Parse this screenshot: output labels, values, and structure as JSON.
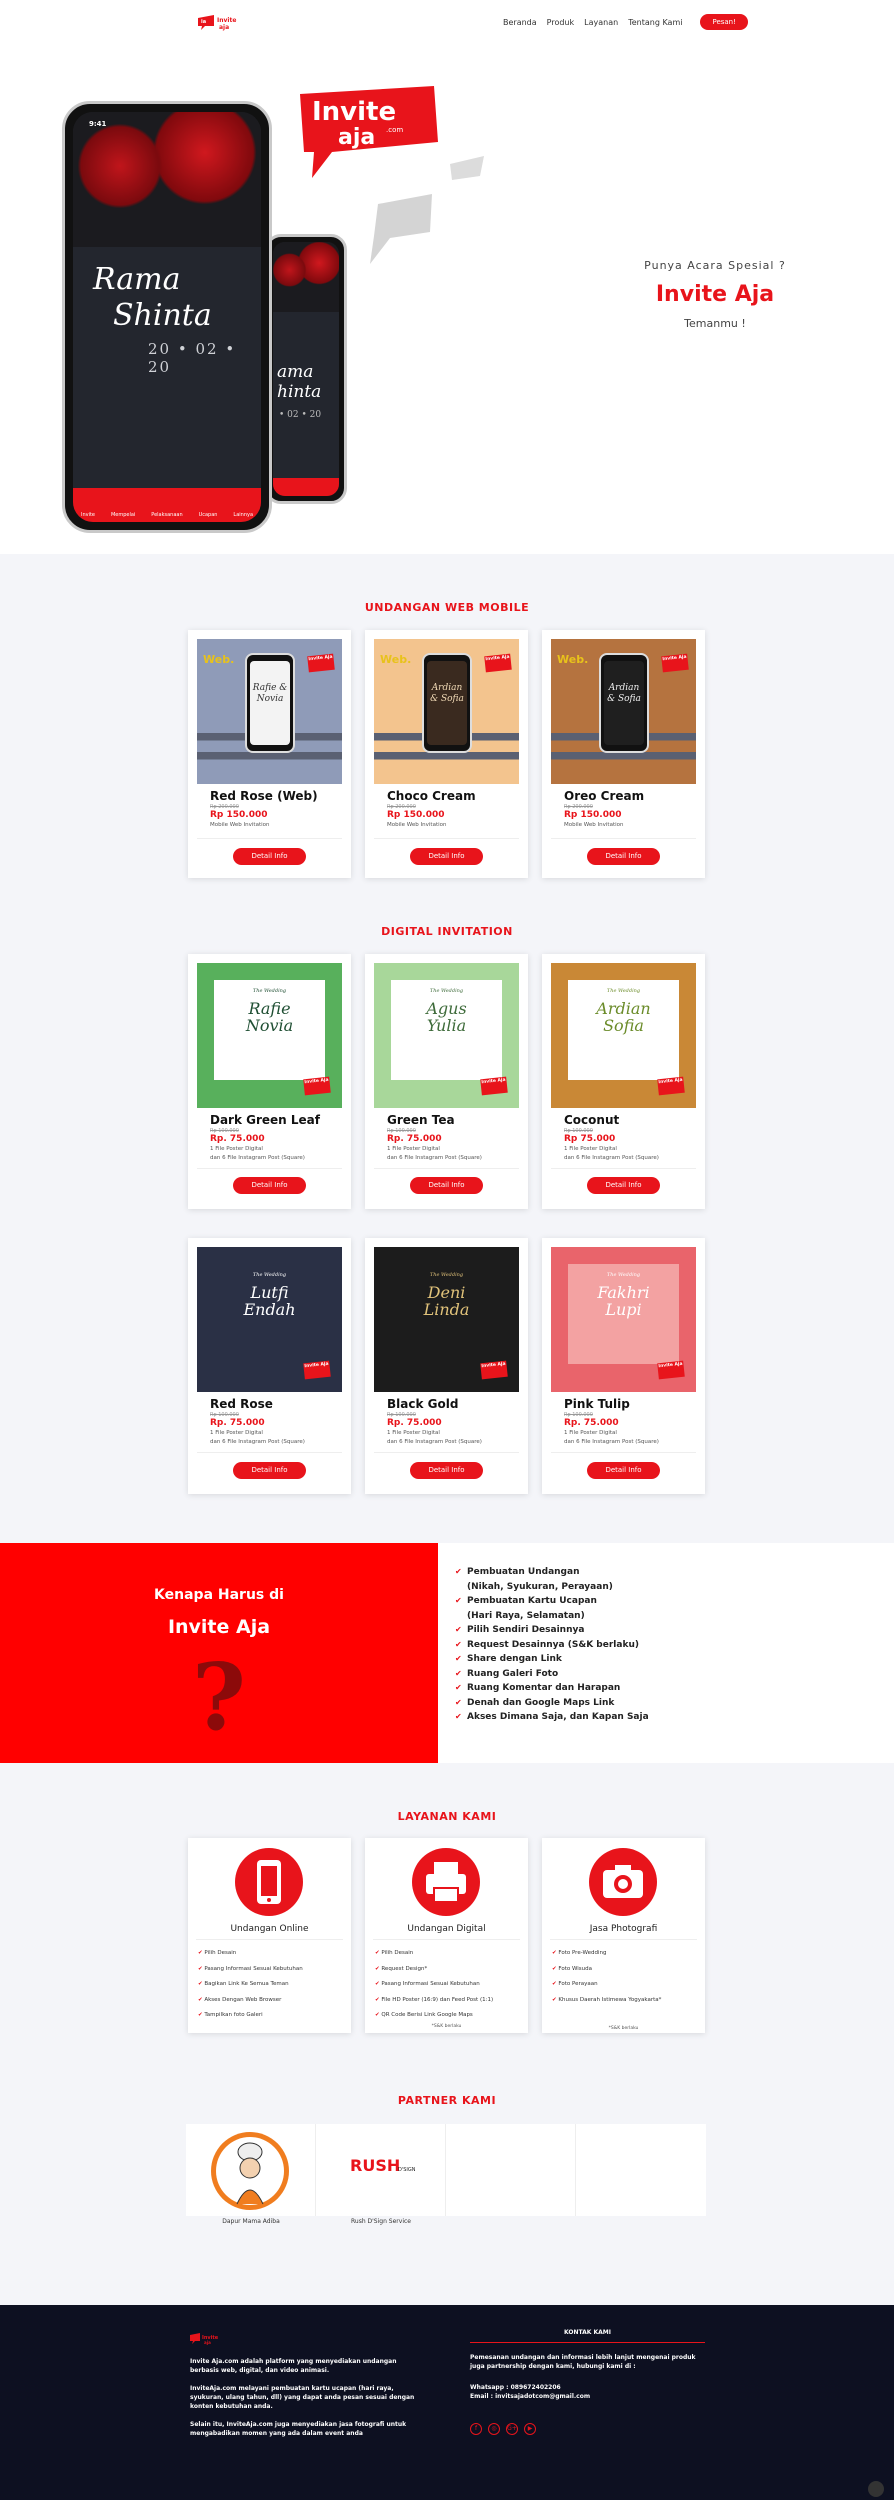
{
  "nav": {
    "logo_text": "Invite Aja",
    "items": [
      "Beranda",
      "Produk",
      "Layanan",
      "Tentang Kami"
    ],
    "cta": "Pesan!"
  },
  "hero": {
    "phone_names_1": "Rama",
    "phone_names_2": "Shinta",
    "phone_date": "20 • 02 • 20",
    "phone_time": "9:41",
    "back_names_1": "ama",
    "back_names_2": "hinta",
    "back_date": "• 02 • 20",
    "tabs": [
      "Invite",
      "Mempelai",
      "Pelaksanaan",
      "Ucapan",
      "Lainnya"
    ],
    "bubble": "Invite aja.com",
    "tag1": "Punya Acara Spesial ?",
    "brand": "Invite Aja",
    "tag2": "Temanmu !"
  },
  "web": {
    "title": "UNDANGAN WEB MOBILE",
    "web_tag": "Web.",
    "flag": "Invite Aja",
    "cards": [
      {
        "name": "Red Rose (Web)",
        "old": "Rp 200.000",
        "price": "Rp 150.000",
        "desc": "Mobile Web Invitation",
        "btn": "Detail Info",
        "mini": "Rafie & Novia",
        "bg": "#8f9bb8",
        "screen": "#f3f3f3",
        "text": "#333"
      },
      {
        "name": "Choco Cream",
        "old": "Rp 200.000",
        "price": "Rp 150.000",
        "desc": "Mobile Web Invitation",
        "btn": "Detail Info",
        "mini": "Ardian & Sofia",
        "bg": "#f3c48e",
        "screen": "#3a2a1f",
        "text": "#f0d9b5"
      },
      {
        "name": "Oreo Cream",
        "old": "Rp 200.000",
        "price": "Rp 150.000",
        "desc": "Mobile Web Invitation",
        "btn": "Detail Info",
        "mini": "Ardian & Sofia",
        "bg": "#b5733f",
        "screen": "#1f1f1f",
        "text": "#eee"
      }
    ]
  },
  "digital": {
    "title": "DIGITAL INVITATION",
    "wedding": "The Wedding",
    "rows": [
      [
        {
          "name": "Dark Green Leaf",
          "old": "Rp 100.000",
          "price": "Rp. 75.000",
          "d1": "1 File Poster Digital",
          "d2": "dan 6 File Instagram Post (Square)",
          "btn": "Detail Info",
          "n1": "Rafie",
          "n2": "Novia",
          "bg": "#58b05c",
          "ink": "#1f4f33"
        },
        {
          "name": "Green Tea",
          "old": "Rp 100.000",
          "price": "Rp. 75.000",
          "d1": "1 File Poster Digital",
          "d2": "dan 6 File Instagram Post (Square)",
          "btn": "Detail Info",
          "n1": "Agus",
          "n2": "Yulia",
          "bg": "#a8d79a",
          "ink": "#3e6b3a"
        },
        {
          "name": "Coconut",
          "old": "Rp 100.000",
          "price": "Rp 75.000",
          "d1": "1 File Poster Digital",
          "d2": "dan 6 File Instagram Post (Square)",
          "btn": "Detail Info",
          "n1": "Ardian",
          "n2": "Sofia",
          "bg": "#c98836",
          "ink": "#6b8c2a"
        }
      ],
      [
        {
          "name": "Red Rose",
          "old": "Rp 100.000",
          "price": "Rp. 75.000",
          "d1": "1 File Poster Digital",
          "d2": "dan 6 File Instagram Post (Square)",
          "btn": "Detail Info",
          "n1": "Lutfi",
          "n2": "Endah",
          "bg": "#2a3045",
          "ink": "#ffffff",
          "sq": "#2a3045"
        },
        {
          "name": "Black Gold",
          "old": "Rp 100.000",
          "price": "Rp. 75.000",
          "d1": "1 File Poster Digital",
          "d2": "dan 6 File Instagram Post (Square)",
          "btn": "Detail Info",
          "n1": "Deni",
          "n2": "Linda",
          "bg": "#1c1c1c",
          "ink": "#e0c27a",
          "sq": "#1c1c1c"
        },
        {
          "name": "Pink Tulip",
          "old": "Rp 100.000",
          "price": "Rp. 75.000",
          "d1": "1 File Poster Digital",
          "d2": "dan 6 File Instagram Post (Square)",
          "btn": "Detail Info",
          "n1": "Fakhri",
          "n2": "Lupi",
          "bg": "#e9646b",
          "ink": "#ffffff",
          "sq": "#f3a2a2"
        }
      ]
    ]
  },
  "why": {
    "line1": "Kenapa Harus di",
    "line2": "Invite Aja",
    "qmark": "?",
    "items": [
      "Pembuatan Undangan",
      "(Nikah, Syukuran, Perayaan)",
      "Pembuatan Kartu Ucapan",
      "(Hari Raya, Selamatan)",
      "Pilih Sendiri Desainnya",
      "Request Desainnya (S&K berlaku)",
      "Share dengan Link",
      "Ruang Galeri Foto",
      "Ruang Komentar dan Harapan",
      "Denah dan Google Maps Link",
      "Akses Dimana Saja, dan Kapan Saja"
    ]
  },
  "services": {
    "title": "LAYANAN KAMI",
    "cards": [
      {
        "name": "Undangan Online",
        "icon": "phone-icon",
        "items": [
          "Pilih Desain",
          "Pasang Informasi Sesuai Kebutuhan",
          "Bagikan Link Ke Semua Teman",
          "Akses Dengan Web Browser",
          "Tampilkan foto Galeri"
        ],
        "note": ""
      },
      {
        "name": "Undangan Digital",
        "icon": "printer-icon",
        "items": [
          "Pilih Desain",
          "Request Design*",
          "Pasang Informasi Sesuai Kebutuhan",
          "File HD Poster (16:9) dan Feed Post (1:1)",
          "QR Code Berisi Link Google Maps"
        ],
        "note": "*S&K berlaku"
      },
      {
        "name": "Jasa Photografi",
        "icon": "camera-icon",
        "items": [
          "Foto Pre-Wedding",
          "Foto Wisuda",
          "Foto Perayaan",
          "Khusus Daerah Istimewa Yogyakarta*"
        ],
        "note": "*S&K berlaku"
      }
    ]
  },
  "partners": {
    "title": "PARTNER KAMI",
    "items": [
      "Dapur Mama Adiba",
      "Rush D'Sign Service",
      "",
      ""
    ],
    "rush_logo": "RUSH",
    "rush_sub": "D'SIGN"
  },
  "footer": {
    "about": [
      "Invite Aja.com adalah platform yang menyediakan undangan berbasis web, digital, dan video animasi.",
      "InviteAja.com melayani pembuatan kartu ucapan (hari raya, syukuran, ulang tahun, dll) yang dapat anda pesan sesuai dengan konten kebutuhan anda.",
      "Selain itu, InviteAja.com juga menyediakan jasa fotografi untuk mengabadikan momen yang ada dalam event anda"
    ],
    "contact_title": "KONTAK KAMI",
    "contact_text": "Pemesanan undangan dan informasi lebih lanjut mengenai produk juga partnership dengan kami, hubungi kami di :",
    "whatsapp": "Whatsapp : 089672402206",
    "email": "Email : invitsajadotcom@gmail.com",
    "socials": [
      "f",
      "◎",
      "G+",
      "▶"
    ]
  }
}
